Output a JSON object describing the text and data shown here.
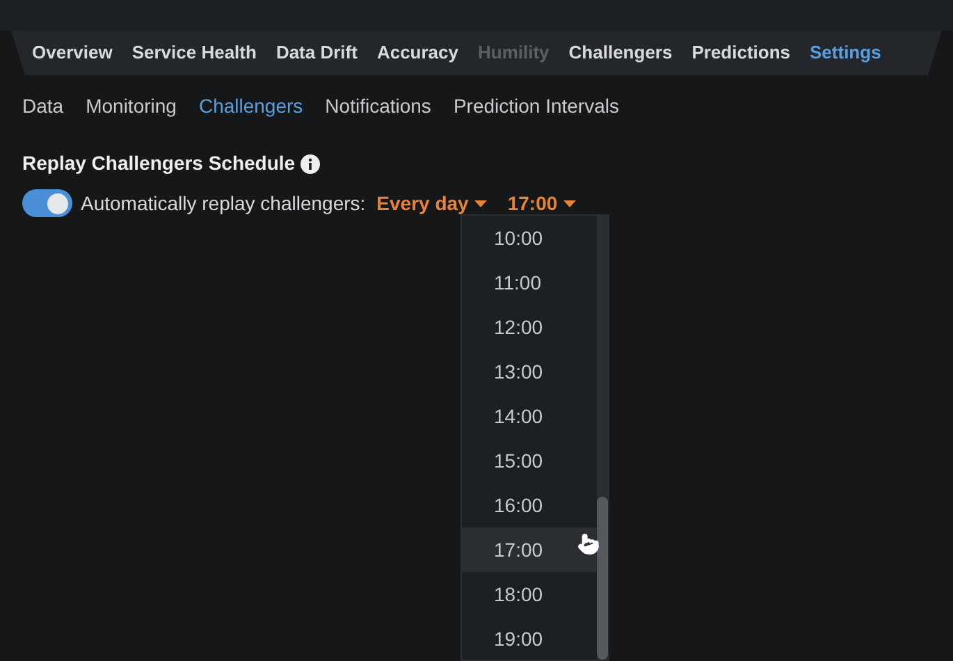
{
  "nav_tabs": [
    {
      "label": "Overview",
      "selected": false,
      "disabled": false
    },
    {
      "label": "Service Health",
      "selected": false,
      "disabled": false
    },
    {
      "label": "Data Drift",
      "selected": false,
      "disabled": false
    },
    {
      "label": "Accuracy",
      "selected": false,
      "disabled": false
    },
    {
      "label": "Humility",
      "selected": false,
      "disabled": true
    },
    {
      "label": "Challengers",
      "selected": false,
      "disabled": false
    },
    {
      "label": "Predictions",
      "selected": false,
      "disabled": false
    },
    {
      "label": "Settings",
      "selected": true,
      "disabled": false
    }
  ],
  "sub_tabs": [
    {
      "label": "Data",
      "selected": false
    },
    {
      "label": "Monitoring",
      "selected": false
    },
    {
      "label": "Challengers",
      "selected": true
    },
    {
      "label": "Notifications",
      "selected": false
    },
    {
      "label": "Prediction Intervals",
      "selected": false
    }
  ],
  "section": {
    "title": "Replay Challengers Schedule",
    "toggle": {
      "on": true,
      "label": "Automatically replay challengers:"
    },
    "frequency": "Every day",
    "time": "17:00"
  },
  "time_options": [
    {
      "label": "10:00",
      "selected": false
    },
    {
      "label": "11:00",
      "selected": false
    },
    {
      "label": "12:00",
      "selected": false
    },
    {
      "label": "13:00",
      "selected": false
    },
    {
      "label": "14:00",
      "selected": false
    },
    {
      "label": "15:00",
      "selected": false
    },
    {
      "label": "16:00",
      "selected": false
    },
    {
      "label": "17:00",
      "selected": true
    },
    {
      "label": "18:00",
      "selected": false
    },
    {
      "label": "19:00",
      "selected": false
    }
  ]
}
